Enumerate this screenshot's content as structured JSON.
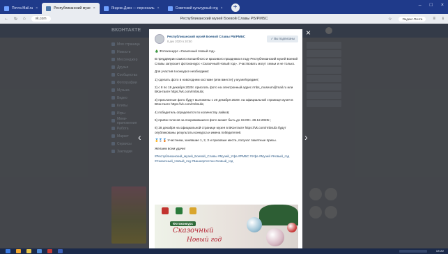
{
  "browser": {
    "tabs": [
      {
        "label": "Почта Mail.ru",
        "active": false
      },
      {
        "label": "Республиканский музе",
        "active": true
      },
      {
        "label": "Яндекс.Дзен — персональ",
        "active": false
      },
      {
        "label": "Советский культурный отд",
        "active": false
      }
    ],
    "address_domain": "vk.com",
    "page_title": "Республиканский музей Боевой Славы РБ/РМБС",
    "right_pill": "Яндекс.Почта",
    "window_controls": [
      "–",
      "□",
      "×"
    ]
  },
  "vk": {
    "logo": "ВКОНТАКТЕ",
    "left_nav": [
      "Моя страница",
      "Новости",
      "Мессенджер",
      "Друзья",
      "Сообщества",
      "Фотографии",
      "Музыка",
      "Видео",
      "Клипы",
      "Игры",
      "Мини-приложения",
      "Работа",
      "Маркет",
      "Сервисы",
      "Закладки"
    ]
  },
  "post": {
    "group_name": "Республиканский музей Боевой Славы РБ/РМБС",
    "date": "8 дек 2020 в 20:50",
    "subscribe_label": "✓ Вы подписаны",
    "paragraphs": [
      "🎄 Фотоконкурс «Сказочный Новый год»",
      "В преддверии самого волшебного и красивого праздника в году Республиканский музей Боевой Славы запускает фотоконкурс «Сказочный Новый год». Участвовать могут семьи и не только.",
      "Для участия в конкурсе необходимо:",
      "1) сделать фото в новогоднем костюме (или вместе) у музея/предмет;",
      "2) с 8 по 19 декабря 2020г. прислать фото на электронный адрес rmbs_museum@mail.ru или ВКонтакте https://vk.com/rmbsufa;",
      "3) присланные фото будут выложены с 20 декабря 2020г. на официальной странице музея в ВКонтакте https://vk.com/rmbsufa;",
      "4) победитель определится по количеству лайков;",
      "5) приём голосов за понравившиеся фото может быть до 15:00ч. 28.12.2020г.;",
      "6) 28 декабря на официальной странице музея в ВКонтакте https://vk.com/rmbsufa будут опубликованы результаты конкурса и имена победителей.",
      "🥇🥈🥉 Участники, занявшие 1, 2, 3 и призовые места, получат памятные призы.",
      "Желаем всем удачи!"
    ],
    "hashtags": "#Республиканский_музей_Боевой_Славы #Музей_Уфа #РМБС #Уфа #Музей #Новый_год #Сказочный_Новый_год #Башкортостан #новый_год",
    "image": {
      "badge": "Фотоконкурс",
      "title_line1": "Сказочный",
      "title_line2": "Новый год"
    },
    "close_icon": "×",
    "prev_arrow": "‹",
    "next_arrow": "›"
  },
  "taskbar": {
    "clock": "14:22"
  }
}
